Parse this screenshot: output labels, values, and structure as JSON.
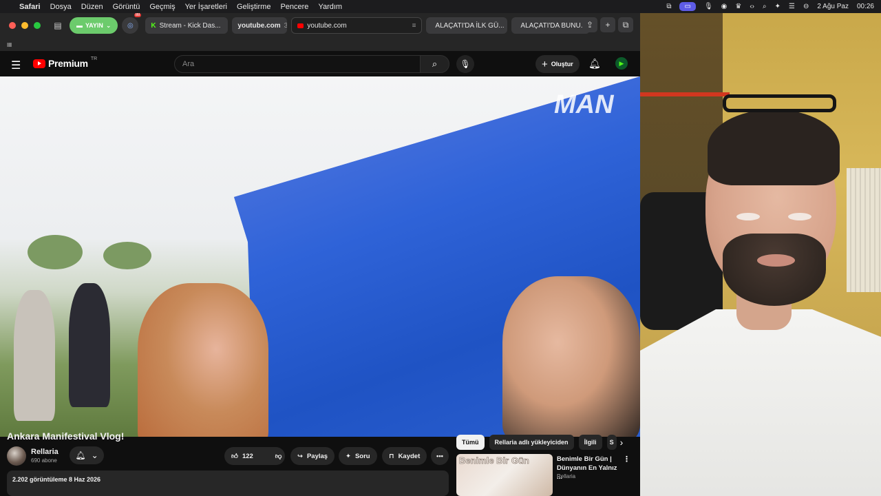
{
  "menubar": {
    "app": "Safari",
    "items": [
      "Dosya",
      "Düzen",
      "Görüntü",
      "Geçmiş",
      "Yer İşaretleri",
      "Geliştirme",
      "Pencere",
      "Yardım"
    ],
    "date": "2 Ağu Paz",
    "time": "00:26"
  },
  "tabbar": {
    "live_label": "YAYIN",
    "ext_badge": "88",
    "tabs": [
      {
        "label": "Stream - Kick Das..."
      },
      {
        "label": "youtube.com",
        "count": "3"
      },
      {
        "label": "youtube.com"
      },
      {
        "label": "ALAÇATI'DA İLK GÜ..."
      },
      {
        "label": "ALAÇATI'DA BUNU..."
      }
    ]
  },
  "youtube": {
    "logo_text": "Premium",
    "logo_region": "TR",
    "search_placeholder": "Ara",
    "create_label": "Oluştur"
  },
  "video": {
    "overlay_text": "MAN"
  },
  "watch": {
    "title": "Ankara Manifestival Vlog!",
    "channel": "Rellaria",
    "subscribers": "690 abone",
    "likes": "122",
    "share_label": "Paylaş",
    "ask_label": "Soru",
    "save_label": "Kaydet",
    "views_date": "2.202 görüntüleme  8 Haz 2026"
  },
  "sidebar": {
    "chips": [
      "Tümü",
      "Rellaria adlı yükleyiciden",
      "İlgili",
      "S"
    ],
    "recommendation": {
      "thumb_text": "Benimle Bir Gün",
      "title": "Benimle Bir Gün | Dünyanın En Yalnız ...",
      "channel": "Rellaria"
    }
  },
  "colors": {
    "youtube_red": "#ff0000",
    "live_green": "#6ccb6c",
    "kick_green": "#53fc18"
  }
}
